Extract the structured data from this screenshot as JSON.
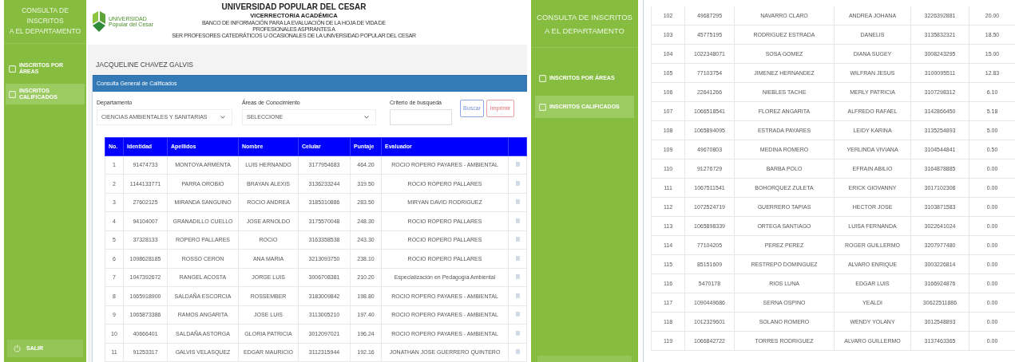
{
  "left_screen": {
    "sidebar": {
      "title_lines": [
        "CONSULTA DE INSCRITOS",
        "A EL DEPARTAMENTO"
      ],
      "items": [
        {
          "label": "INSCRITOS POR ÁREAS",
          "selected": false
        },
        {
          "label": "INSCRITOS CALIFICADOS",
          "selected": true
        }
      ],
      "logout": "SALIR"
    },
    "header": {
      "logo_text": [
        "UNIVERSIDAD",
        "Popular del Cesar"
      ],
      "title": "UNIVERSIDAD POPULAR DEL CESAR",
      "subtitle": "VICERRECTORIA ACADÉMICA",
      "description": "BANCO DE INFORMACIÓN PARA LA EVALUACIÓN DE LA HOJA DE VIDA DE\nPROFESIONALES ASPIRANTES A\nSER PROFESORES CATEDRÁTICOS U OCASIONALES DE LA UNIVERSIDAD POPULAR DEL CESAR"
    },
    "user_name": "JACQUELINE CHAVEZ GALVIS",
    "panel_title": "Consulta General de Calificados",
    "fields": [
      {
        "kind": "select",
        "label": "Departamento",
        "value": "CIENCIAS AMBIENTALES Y SANITARIAS"
      },
      {
        "kind": "select",
        "label": "Áreas de Conocimiento",
        "value": "SELECCIONE"
      },
      {
        "kind": "text",
        "label": "Criterio de busqueda"
      }
    ],
    "buttons": [
      {
        "kind": "primary",
        "label": "Buscar"
      },
      {
        "kind": "danger",
        "label": "Imprimir"
      }
    ],
    "table": {
      "columns": [
        "No.",
        "Identidad",
        "Apellidos",
        "Nombre",
        "Celular",
        "Puntaje",
        "Evaluador"
      ],
      "rows": [
        [
          "1",
          "91474733",
          "MONTOYA ARMENTA",
          "LUIS HERNANDO",
          "3177954683",
          "464.20",
          "ROCIO ROPERO PAYARES - AMBIENTAL"
        ],
        [
          "2",
          "1144133771",
          "PARRA OROBIO",
          "BRAYAN ALEXIS",
          "3136233244",
          "319.50",
          "ROCIO ROPERO PALLARES"
        ],
        [
          "3",
          "27602125",
          "MIRANDA SANGUINO",
          "ROCIO ANDREA",
          "3185310886",
          "283.50",
          "MIRYAN DAVID RODRIGUEZ"
        ],
        [
          "4",
          "94104007",
          "GRANADILLO CUELLO",
          "JOSE ARNOLDO",
          "3175570048",
          "248.30",
          "ROCIO ROPERO PALLARES"
        ],
        [
          "5",
          "37328133",
          "ROPERO PALLARES",
          "ROCIO",
          "3163358538",
          "243.30",
          "ROCIO ROPERO PALLARES"
        ],
        [
          "6",
          "1098628185",
          "ROSSO CERON",
          "ANA MARIA",
          "3213093750",
          "238.10",
          "ROCIO ROPERO PALLARES"
        ],
        [
          "7",
          "1047392672",
          "RANGEL ACOSTA",
          "JORGE LUIS",
          "3006708381",
          "210.20",
          "Especialización en Pedagogía Ambiental"
        ],
        [
          "8",
          "1065918900",
          "SALDAÑA ESCORCIA",
          "ROSSEMBER",
          "3183009842",
          "198.80",
          "ROCIO ROPERO PAYARES - AMBIENTAL"
        ],
        [
          "9",
          "1065873386",
          "RAMOS ANGARITA",
          "JOSE LUIS",
          "3113005210",
          "197.40",
          "ROCIO ROPERO PAYARES - AMBIENTAL"
        ],
        [
          "10",
          "40666401",
          "SALDAÑA ASTORGA",
          "GLORIA PATRICIA",
          "3012097021",
          "196.24",
          "ROCIO ROPERO PAYARES - AMBIENTAL"
        ],
        [
          "11",
          "91253317",
          "GALVIS VELASQUEZ",
          "EDGAR MAURICIO",
          "3112315944",
          "192.16",
          "JONATHAN JOSE GUERRERO QUINTERO"
        ]
      ]
    }
  },
  "right_screen": {
    "sidebar": {
      "title_lines": [
        "CONSULTA DE INSCRITOS",
        "A EL DEPARTAMENTO"
      ],
      "items": [
        {
          "label": "INSCRITOS POR ÁREAS",
          "selected": false
        },
        {
          "label": "INSCRITOS CALIFICADOS",
          "selected": true
        }
      ]
    },
    "table": {
      "rows": [
        [
          "102",
          "49687295",
          "NAVARRO CLARO",
          "ANDREA JOHANA",
          "3226392881",
          "20.00"
        ],
        [
          "103",
          "45775195",
          "RODRIGUEZ ESTRADA",
          "DANELIS",
          "3135832321",
          "18.50"
        ],
        [
          "104",
          "1022348071",
          "SOSA GOMEZ",
          "DIANA SUGEY",
          "3008243295",
          "15.00"
        ],
        [
          "105",
          "77103754",
          "JIMENEZ HERNANDEZ",
          "WILFRAN JESUS",
          "3100095511",
          "12.83"
        ],
        [
          "106",
          "22641266",
          "NIEBLES TACHE",
          "MERLY PATRICIA",
          "3107298312",
          "6.10"
        ],
        [
          "107",
          "1066518541",
          "FLOREZ ANGARITA",
          "ALFREDO RAFAEL",
          "3142866450",
          "5.18"
        ],
        [
          "108",
          "1065894095",
          "ESTRADA PAYARES",
          "LEIDY KARINA",
          "3135254893",
          "5.00"
        ],
        [
          "109",
          "49670803",
          "MEDINA ROMERO",
          "YERLINDA VIVIANA",
          "3104544841",
          "0.50"
        ],
        [
          "110",
          "91276729",
          "BARBA POLO",
          "EFRAIN ABILIO",
          "3164878885",
          "0.00"
        ],
        [
          "111",
          "1067511541",
          "BOHORQUEZ ZULETA",
          "ERICK GIOVANNY",
          "3017102308",
          "0.00"
        ],
        [
          "112",
          "1072524719",
          "GUERRERO TAPIAS",
          "HECTOR JOSE",
          "3103871583",
          "0.00"
        ],
        [
          "113",
          "1065898339",
          "ORTEGA SANTIAGO",
          "LUISA FERNANDA",
          "3022641024",
          "0.00"
        ],
        [
          "114",
          "77104205",
          "PEREZ PEREZ",
          "ROGER GUILLERMO",
          "3207977480",
          "0.00"
        ],
        [
          "115",
          "85151609",
          "RESTREPO DOMINGUEZ",
          "ALVARO ENRIQUE",
          "3003226814",
          "0.00"
        ],
        [
          "116",
          "5470178",
          "RIOS LUNA",
          "EDGAR LUIS",
          "3166924876",
          "0.00"
        ],
        [
          "117",
          "1090449686",
          "SERNA OSPINO",
          "YEALDI",
          "30622511886",
          "0.00"
        ],
        [
          "118",
          "1012329601",
          "SOLANO ROMERO",
          "WENDY YOLANY",
          "3012548893",
          "0.00"
        ],
        [
          "119",
          "1066842722",
          "TORRES RODRIGUEZ",
          "ALVARO GUILLERMO",
          "3137463365",
          "0.00"
        ]
      ]
    }
  }
}
